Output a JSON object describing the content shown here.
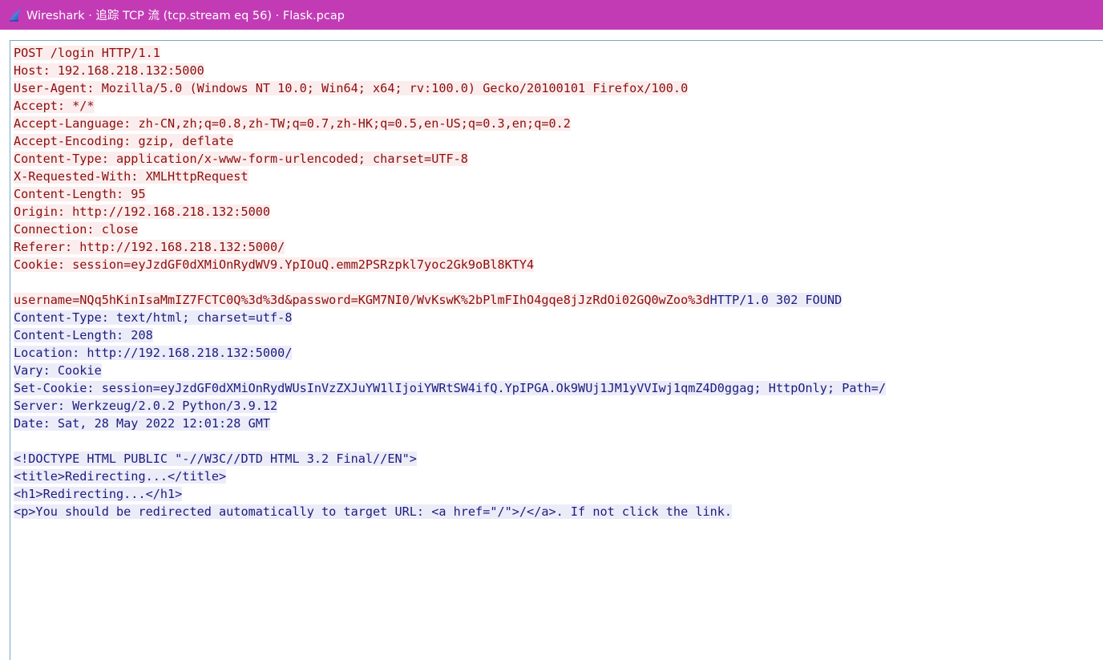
{
  "window": {
    "title": "Wireshark · 追踪 TCP 流 (tcp.stream eq 56) · Flask.pcap",
    "icon": "wireshark-fin-icon"
  },
  "colors": {
    "titlebar": "#c23bb5",
    "client_text": "#8b0f0f",
    "client_bg": "#fbeded",
    "server_text": "#1c1c7d",
    "server_bg": "#ececf9"
  },
  "stream": {
    "lines": [
      {
        "segments": [
          {
            "dir": "client",
            "text": "POST /login HTTP/1.1"
          }
        ]
      },
      {
        "segments": [
          {
            "dir": "client",
            "text": "Host: 192.168.218.132:5000"
          }
        ]
      },
      {
        "segments": [
          {
            "dir": "client",
            "text": "User-Agent: Mozilla/5.0 (Windows NT 10.0; Win64; x64; rv:100.0) Gecko/20100101 Firefox/100.0"
          }
        ]
      },
      {
        "segments": [
          {
            "dir": "client",
            "text": "Accept: */*"
          }
        ]
      },
      {
        "segments": [
          {
            "dir": "client",
            "text": "Accept-Language: zh-CN,zh;q=0.8,zh-TW;q=0.7,zh-HK;q=0.5,en-US;q=0.3,en;q=0.2"
          }
        ]
      },
      {
        "segments": [
          {
            "dir": "client",
            "text": "Accept-Encoding: gzip, deflate"
          }
        ]
      },
      {
        "segments": [
          {
            "dir": "client",
            "text": "Content-Type: application/x-www-form-urlencoded; charset=UTF-8"
          }
        ]
      },
      {
        "segments": [
          {
            "dir": "client",
            "text": "X-Requested-With: XMLHttpRequest"
          }
        ]
      },
      {
        "segments": [
          {
            "dir": "client",
            "text": "Content-Length: 95"
          }
        ]
      },
      {
        "segments": [
          {
            "dir": "client",
            "text": "Origin: http://192.168.218.132:5000"
          }
        ]
      },
      {
        "segments": [
          {
            "dir": "client",
            "text": "Connection: close"
          }
        ]
      },
      {
        "segments": [
          {
            "dir": "client",
            "text": "Referer: http://192.168.218.132:5000/"
          }
        ]
      },
      {
        "segments": [
          {
            "dir": "client",
            "text": "Cookie: session=eyJzdGF0dXMiOnRydWV9.YpIOuQ.emm2PSRzpkl7yoc2Gk9oBl8KTY4"
          }
        ]
      },
      {
        "segments": []
      },
      {
        "segments": [
          {
            "dir": "client",
            "text": "username=NQq5hKinIsaMmIZ7FCTC0Q%3d%3d&password=KGM7NI0/WvKswK%2bPlmFIhO4gqe8jJzRdOi02GQ0wZoo%3d"
          },
          {
            "dir": "server",
            "text": "HTTP/1.0 302 FOUND"
          }
        ]
      },
      {
        "segments": [
          {
            "dir": "server",
            "text": "Content-Type: text/html; charset=utf-8"
          }
        ]
      },
      {
        "segments": [
          {
            "dir": "server",
            "text": "Content-Length: 208"
          }
        ]
      },
      {
        "segments": [
          {
            "dir": "server",
            "text": "Location: http://192.168.218.132:5000/"
          }
        ]
      },
      {
        "segments": [
          {
            "dir": "server",
            "text": "Vary: Cookie"
          }
        ]
      },
      {
        "segments": [
          {
            "dir": "server",
            "text": "Set-Cookie: session=eyJzdGF0dXMiOnRydWUsInVzZXJuYW1lIjoiYWRtSW4ifQ.YpIPGA.Ok9WUj1JM1yVVIwj1qmZ4D0ggag; HttpOnly; Path=/"
          }
        ]
      },
      {
        "segments": [
          {
            "dir": "server",
            "text": "Server: Werkzeug/2.0.2 Python/3.9.12"
          }
        ]
      },
      {
        "segments": [
          {
            "dir": "server",
            "text": "Date: Sat, 28 May 2022 12:01:28 GMT"
          }
        ]
      },
      {
        "segments": []
      },
      {
        "segments": [
          {
            "dir": "server",
            "text": "<!DOCTYPE HTML PUBLIC \"-//W3C//DTD HTML 3.2 Final//EN\">"
          }
        ]
      },
      {
        "segments": [
          {
            "dir": "server",
            "text": "<title>Redirecting...</title>"
          }
        ]
      },
      {
        "segments": [
          {
            "dir": "server",
            "text": "<h1>Redirecting...</h1>"
          }
        ]
      },
      {
        "segments": [
          {
            "dir": "server",
            "text": "<p>You should be redirected automatically to target URL: <a href=\"/\">/</a>. If not click the link."
          }
        ]
      }
    ]
  }
}
